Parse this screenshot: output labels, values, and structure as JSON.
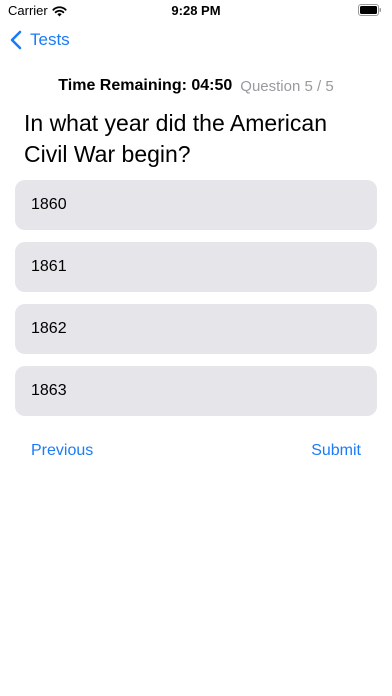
{
  "status_bar": {
    "carrier": "Carrier",
    "time": "9:28 PM"
  },
  "nav": {
    "back_label": "Tests"
  },
  "header": {
    "timer": "Time Remaining: 04:50",
    "counter": "Question 5 / 5"
  },
  "question": {
    "text": "In what year did the American Civil War begin?"
  },
  "options": [
    {
      "label": "1860"
    },
    {
      "label": "1861"
    },
    {
      "label": "1862"
    },
    {
      "label": "1863"
    }
  ],
  "buttons": {
    "previous": "Previous",
    "submit": "Submit"
  },
  "colors": {
    "accent": "#1a7cf7",
    "option_background": "#e5e5ea",
    "secondary_text": "#9a9a9e"
  }
}
